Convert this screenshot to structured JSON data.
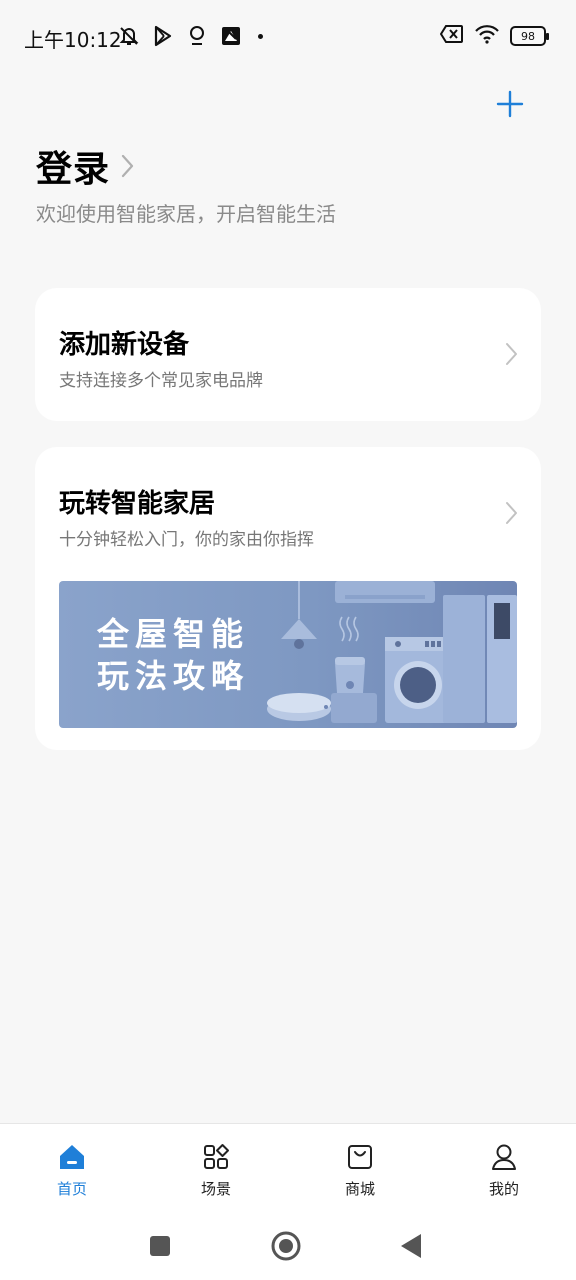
{
  "status_bar": {
    "time": "上午10:12",
    "battery_level": "98",
    "icons_left": [
      "mute-bell-icon",
      "play-store-icon",
      "location-pin-icon",
      "app-notification-icon"
    ],
    "icons_right": [
      "sim-error-icon",
      "wifi-icon",
      "battery-icon"
    ]
  },
  "header": {
    "add_icon": "plus-icon",
    "login_title": "登录",
    "login_subtitle": "欢迎使用智能家居，开启智能生活"
  },
  "cards": {
    "add_device": {
      "title": "添加新设备",
      "description": "支持连接多个常见家电品牌"
    },
    "smart_home_guide": {
      "title": "玩转智能家居",
      "description": "十分钟轻松入门，你的家由你指挥",
      "banner_line1": "全屋智能",
      "banner_line2": "玩法攻略"
    }
  },
  "bottom_nav": {
    "items": [
      {
        "label": "首页",
        "icon": "home-icon",
        "active": true
      },
      {
        "label": "场景",
        "icon": "scenes-grid-icon",
        "active": false
      },
      {
        "label": "商城",
        "icon": "shopping-bag-icon",
        "active": false
      },
      {
        "label": "我的",
        "icon": "profile-icon",
        "active": false
      }
    ]
  },
  "colors": {
    "accent": "#1f7fd8",
    "background": "#f7f7f7",
    "banner": "#7e98c2"
  }
}
